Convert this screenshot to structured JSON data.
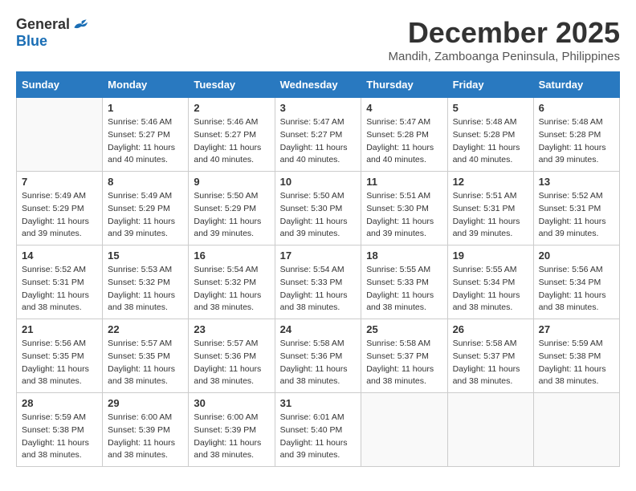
{
  "logo": {
    "general": "General",
    "blue": "Blue"
  },
  "title": "December 2025",
  "subtitle": "Mandih, Zamboanga Peninsula, Philippines",
  "days_of_week": [
    "Sunday",
    "Monday",
    "Tuesday",
    "Wednesday",
    "Thursday",
    "Friday",
    "Saturday"
  ],
  "weeks": [
    [
      {
        "day": "",
        "sunrise": "",
        "sunset": "",
        "daylight": "",
        "empty": true
      },
      {
        "day": "1",
        "sunrise": "Sunrise: 5:46 AM",
        "sunset": "Sunset: 5:27 PM",
        "daylight": "Daylight: 11 hours and 40 minutes.",
        "empty": false
      },
      {
        "day": "2",
        "sunrise": "Sunrise: 5:46 AM",
        "sunset": "Sunset: 5:27 PM",
        "daylight": "Daylight: 11 hours and 40 minutes.",
        "empty": false
      },
      {
        "day": "3",
        "sunrise": "Sunrise: 5:47 AM",
        "sunset": "Sunset: 5:27 PM",
        "daylight": "Daylight: 11 hours and 40 minutes.",
        "empty": false
      },
      {
        "day": "4",
        "sunrise": "Sunrise: 5:47 AM",
        "sunset": "Sunset: 5:28 PM",
        "daylight": "Daylight: 11 hours and 40 minutes.",
        "empty": false
      },
      {
        "day": "5",
        "sunrise": "Sunrise: 5:48 AM",
        "sunset": "Sunset: 5:28 PM",
        "daylight": "Daylight: 11 hours and 40 minutes.",
        "empty": false
      },
      {
        "day": "6",
        "sunrise": "Sunrise: 5:48 AM",
        "sunset": "Sunset: 5:28 PM",
        "daylight": "Daylight: 11 hours and 39 minutes.",
        "empty": false
      }
    ],
    [
      {
        "day": "7",
        "sunrise": "Sunrise: 5:49 AM",
        "sunset": "Sunset: 5:29 PM",
        "daylight": "Daylight: 11 hours and 39 minutes.",
        "empty": false
      },
      {
        "day": "8",
        "sunrise": "Sunrise: 5:49 AM",
        "sunset": "Sunset: 5:29 PM",
        "daylight": "Daylight: 11 hours and 39 minutes.",
        "empty": false
      },
      {
        "day": "9",
        "sunrise": "Sunrise: 5:50 AM",
        "sunset": "Sunset: 5:29 PM",
        "daylight": "Daylight: 11 hours and 39 minutes.",
        "empty": false
      },
      {
        "day": "10",
        "sunrise": "Sunrise: 5:50 AM",
        "sunset": "Sunset: 5:30 PM",
        "daylight": "Daylight: 11 hours and 39 minutes.",
        "empty": false
      },
      {
        "day": "11",
        "sunrise": "Sunrise: 5:51 AM",
        "sunset": "Sunset: 5:30 PM",
        "daylight": "Daylight: 11 hours and 39 minutes.",
        "empty": false
      },
      {
        "day": "12",
        "sunrise": "Sunrise: 5:51 AM",
        "sunset": "Sunset: 5:31 PM",
        "daylight": "Daylight: 11 hours and 39 minutes.",
        "empty": false
      },
      {
        "day": "13",
        "sunrise": "Sunrise: 5:52 AM",
        "sunset": "Sunset: 5:31 PM",
        "daylight": "Daylight: 11 hours and 39 minutes.",
        "empty": false
      }
    ],
    [
      {
        "day": "14",
        "sunrise": "Sunrise: 5:52 AM",
        "sunset": "Sunset: 5:31 PM",
        "daylight": "Daylight: 11 hours and 38 minutes.",
        "empty": false
      },
      {
        "day": "15",
        "sunrise": "Sunrise: 5:53 AM",
        "sunset": "Sunset: 5:32 PM",
        "daylight": "Daylight: 11 hours and 38 minutes.",
        "empty": false
      },
      {
        "day": "16",
        "sunrise": "Sunrise: 5:54 AM",
        "sunset": "Sunset: 5:32 PM",
        "daylight": "Daylight: 11 hours and 38 minutes.",
        "empty": false
      },
      {
        "day": "17",
        "sunrise": "Sunrise: 5:54 AM",
        "sunset": "Sunset: 5:33 PM",
        "daylight": "Daylight: 11 hours and 38 minutes.",
        "empty": false
      },
      {
        "day": "18",
        "sunrise": "Sunrise: 5:55 AM",
        "sunset": "Sunset: 5:33 PM",
        "daylight": "Daylight: 11 hours and 38 minutes.",
        "empty": false
      },
      {
        "day": "19",
        "sunrise": "Sunrise: 5:55 AM",
        "sunset": "Sunset: 5:34 PM",
        "daylight": "Daylight: 11 hours and 38 minutes.",
        "empty": false
      },
      {
        "day": "20",
        "sunrise": "Sunrise: 5:56 AM",
        "sunset": "Sunset: 5:34 PM",
        "daylight": "Daylight: 11 hours and 38 minutes.",
        "empty": false
      }
    ],
    [
      {
        "day": "21",
        "sunrise": "Sunrise: 5:56 AM",
        "sunset": "Sunset: 5:35 PM",
        "daylight": "Daylight: 11 hours and 38 minutes.",
        "empty": false
      },
      {
        "day": "22",
        "sunrise": "Sunrise: 5:57 AM",
        "sunset": "Sunset: 5:35 PM",
        "daylight": "Daylight: 11 hours and 38 minutes.",
        "empty": false
      },
      {
        "day": "23",
        "sunrise": "Sunrise: 5:57 AM",
        "sunset": "Sunset: 5:36 PM",
        "daylight": "Daylight: 11 hours and 38 minutes.",
        "empty": false
      },
      {
        "day": "24",
        "sunrise": "Sunrise: 5:58 AM",
        "sunset": "Sunset: 5:36 PM",
        "daylight": "Daylight: 11 hours and 38 minutes.",
        "empty": false
      },
      {
        "day": "25",
        "sunrise": "Sunrise: 5:58 AM",
        "sunset": "Sunset: 5:37 PM",
        "daylight": "Daylight: 11 hours and 38 minutes.",
        "empty": false
      },
      {
        "day": "26",
        "sunrise": "Sunrise: 5:58 AM",
        "sunset": "Sunset: 5:37 PM",
        "daylight": "Daylight: 11 hours and 38 minutes.",
        "empty": false
      },
      {
        "day": "27",
        "sunrise": "Sunrise: 5:59 AM",
        "sunset": "Sunset: 5:38 PM",
        "daylight": "Daylight: 11 hours and 38 minutes.",
        "empty": false
      }
    ],
    [
      {
        "day": "28",
        "sunrise": "Sunrise: 5:59 AM",
        "sunset": "Sunset: 5:38 PM",
        "daylight": "Daylight: 11 hours and 38 minutes.",
        "empty": false
      },
      {
        "day": "29",
        "sunrise": "Sunrise: 6:00 AM",
        "sunset": "Sunset: 5:39 PM",
        "daylight": "Daylight: 11 hours and 38 minutes.",
        "empty": false
      },
      {
        "day": "30",
        "sunrise": "Sunrise: 6:00 AM",
        "sunset": "Sunset: 5:39 PM",
        "daylight": "Daylight: 11 hours and 38 minutes.",
        "empty": false
      },
      {
        "day": "31",
        "sunrise": "Sunrise: 6:01 AM",
        "sunset": "Sunset: 5:40 PM",
        "daylight": "Daylight: 11 hours and 39 minutes.",
        "empty": false
      },
      {
        "day": "",
        "sunrise": "",
        "sunset": "",
        "daylight": "",
        "empty": true
      },
      {
        "day": "",
        "sunrise": "",
        "sunset": "",
        "daylight": "",
        "empty": true
      },
      {
        "day": "",
        "sunrise": "",
        "sunset": "",
        "daylight": "",
        "empty": true
      }
    ]
  ]
}
